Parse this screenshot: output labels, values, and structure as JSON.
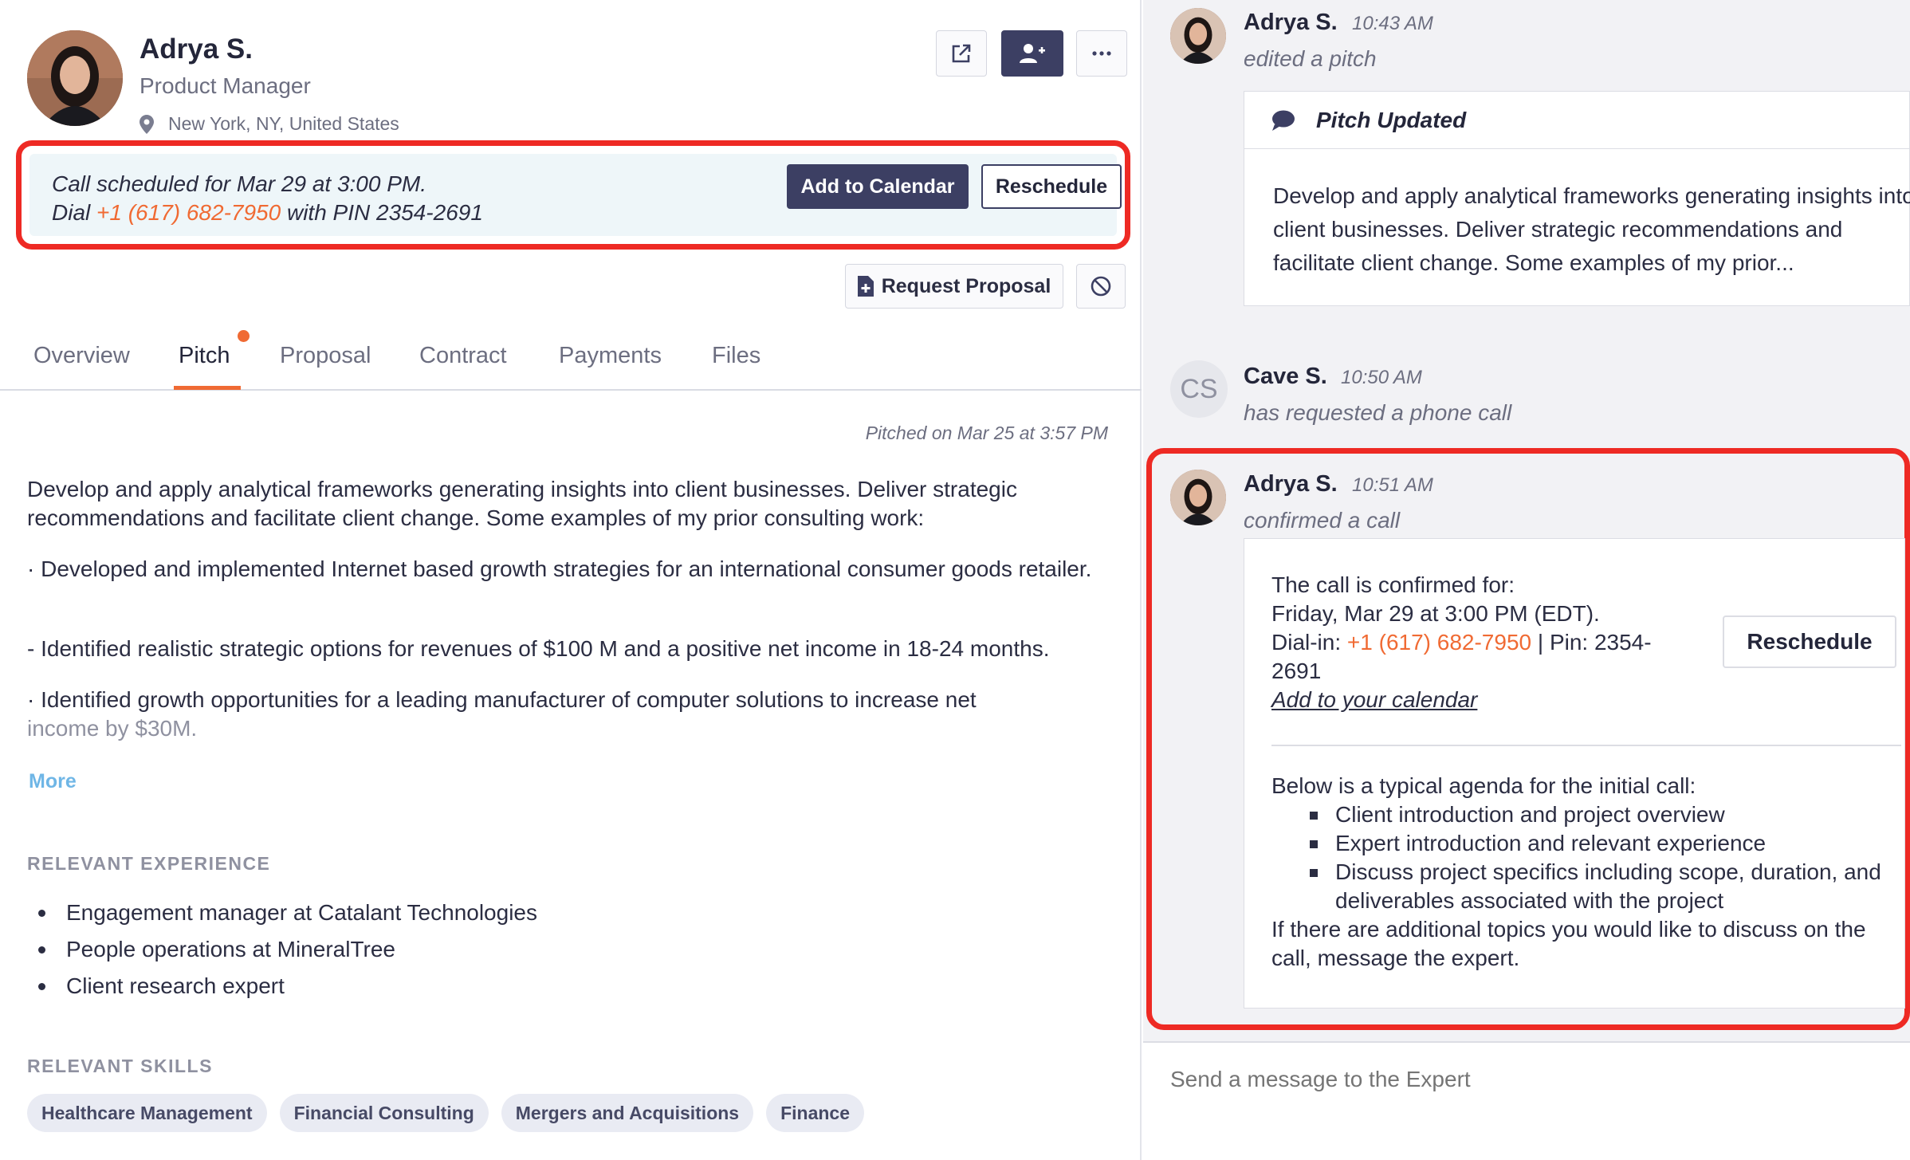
{
  "profile": {
    "name": "Adrya S.",
    "role": "Product Manager",
    "location": "New York, NY, United States",
    "icons": [
      "external-link-icon",
      "add-user-icon",
      "more-icon",
      "location-pin-icon"
    ]
  },
  "call_banner": {
    "line1": "Call scheduled for Mar 29 at 3:00 PM.",
    "dial_prefix": "Dial ",
    "phone": "+1 (617) 682-7950",
    "dial_suffix": " with PIN 2354-2691",
    "add_calendar_label": "Add to Calendar",
    "reschedule_label": "Reschedule"
  },
  "actions": {
    "request_proposal_label": "Request Proposal",
    "request_icon": "document-plus-icon",
    "block_icon": "block-icon"
  },
  "tabs": [
    {
      "label": "Overview"
    },
    {
      "label": "Pitch"
    },
    {
      "label": "Proposal"
    },
    {
      "label": "Contract"
    },
    {
      "label": "Payments"
    },
    {
      "label": "Files"
    }
  ],
  "pitch": {
    "pitched_on": "Pitched on Mar 25 at 3:57 PM",
    "para1": "Develop and apply analytical frameworks generating insights into client businesses. Deliver strategic recommendations and facilitate client change. Some examples of my prior consulting work:",
    "para2": "· Developed and implemented Internet based growth strategies for an international consumer goods retailer.",
    "para3": "- Identified realistic strategic options for revenues of $100 M and a positive net income in 18-24 months.",
    "para4_a": "· Identified growth opportunities for a leading manufacturer of computer solutions to increase net",
    "para4_b": "income by $30M.",
    "more_label": "More"
  },
  "experience": {
    "heading": "RELEVANT EXPERIENCE",
    "items": [
      "Engagement manager at Catalant Technologies",
      "People operations at MineralTree",
      "Client research expert"
    ]
  },
  "skills": {
    "heading": "RELEVANT SKILLS",
    "items": [
      "Healthcare Management",
      "Financial Consulting",
      "Mergers and Acquisitions",
      "Finance"
    ]
  },
  "activity": {
    "msg1": {
      "name": "Adrya S.",
      "time": "10:43 AM",
      "action": "edited a pitch",
      "card_title": "Pitch Updated",
      "card_icon": "chat-bubble-icon",
      "card_body": "Develop and apply analytical frameworks generating insights into client businesses. Deliver strategic recommendations and facilitate client change. Some examples of my prior..."
    },
    "msg2": {
      "initials": "CS",
      "name": "Cave S.",
      "time": "10:50 AM",
      "action": "has requested a phone call"
    },
    "msg3": {
      "name": "Adrya S.",
      "time": "10:51 AM",
      "action": "confirmed a call",
      "confirmed_for": "The call is confirmed for:",
      "datetime": "Friday, Mar 29 at 3:00 PM (EDT).",
      "dialin_label": "Dial-in: ",
      "phone": "+1 (617) 682-7950",
      "pin": " | Pin: 2354-2691",
      "calendar_link": "Add to your calendar",
      "reschedule_label": "Reschedule",
      "agenda_intro": "Below is a typical agenda for the initial call:",
      "agenda_items": [
        "Client introduction and project overview",
        "Expert introduction and relevant experience",
        "Discuss project specifics including scope, duration, and deliverables associated with the project"
      ],
      "agenda_outro": "If there are additional topics you would like to discuss on the call, message the expert."
    },
    "composer_placeholder": "Send a message to the Expert"
  },
  "colors": {
    "accent_orange": "#f06a33",
    "primary_navy": "#3c3f63",
    "highlight_red": "#ee2a24",
    "link_blue": "#6fb6e6"
  }
}
